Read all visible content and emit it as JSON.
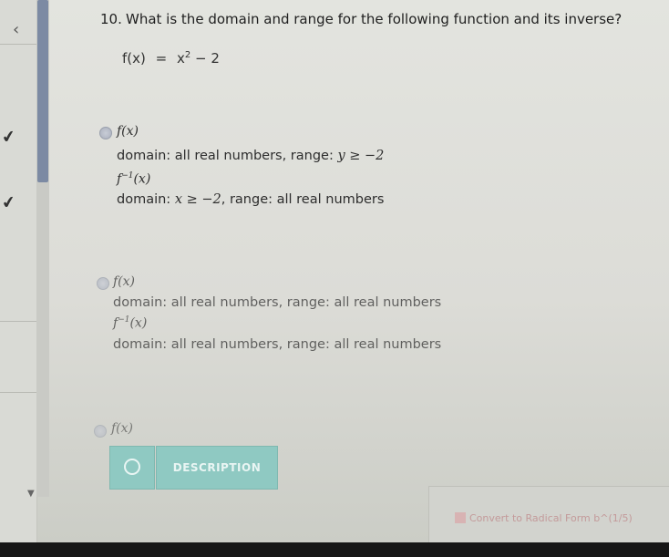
{
  "question": {
    "number": "10.",
    "text": "What is the domain and range for the following function and its inverse?",
    "function": {
      "lhs": "f(x)",
      "eq": "=",
      "base": "x",
      "exp": "2",
      "rest": " − 2"
    }
  },
  "options": [
    {
      "f_label": "f(x)",
      "f_domain_range": "domain: all real numbers, range: ",
      "f_range_math": "y ≥ −2",
      "inv_base": "f",
      "inv_exp": "−1",
      "inv_arg": "(x)",
      "inv_domain_label": "domain: ",
      "inv_domain_math": "x ≥ −2",
      "inv_range": ", range: all real numbers"
    },
    {
      "f_label": "f(x)",
      "f_domain_range": "domain: all real numbers, range: all real numbers",
      "inv_base": "f",
      "inv_exp": "−1",
      "inv_arg": "(x)",
      "inv_domain_range": "domain: all real numbers, range: all real numbers"
    },
    {
      "f_label": "f(x)"
    }
  ],
  "buttons": {
    "check_icon": "circle-icon",
    "description_label": "DESCRIPTION"
  },
  "bottom": {
    "convert_label": "Convert to Radical Form b^(1/5)"
  },
  "nav": {
    "chevron": "‹",
    "check": "✔"
  },
  "colors": {
    "button": "#8fc9c2",
    "scroll_thumb": "#7c8aa3"
  }
}
